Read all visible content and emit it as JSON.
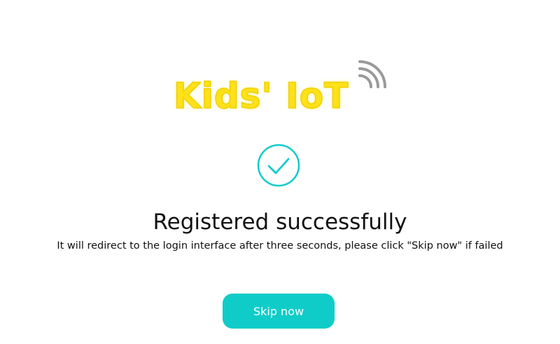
{
  "logo": {
    "text": "Kids' IoT",
    "icon": "wifi-signal-icon"
  },
  "status_icon": "check-circle-icon",
  "message": {
    "title": "Registered successfully",
    "subtitle": "It will redirect to the login interface after three seconds, please click \"Skip now\" if failed"
  },
  "actions": {
    "skip_label": "Skip now"
  },
  "colors": {
    "accent": "#10ccc9",
    "logo_yellow": "#ffe11a",
    "icon_gray": "#9a9a9a"
  }
}
